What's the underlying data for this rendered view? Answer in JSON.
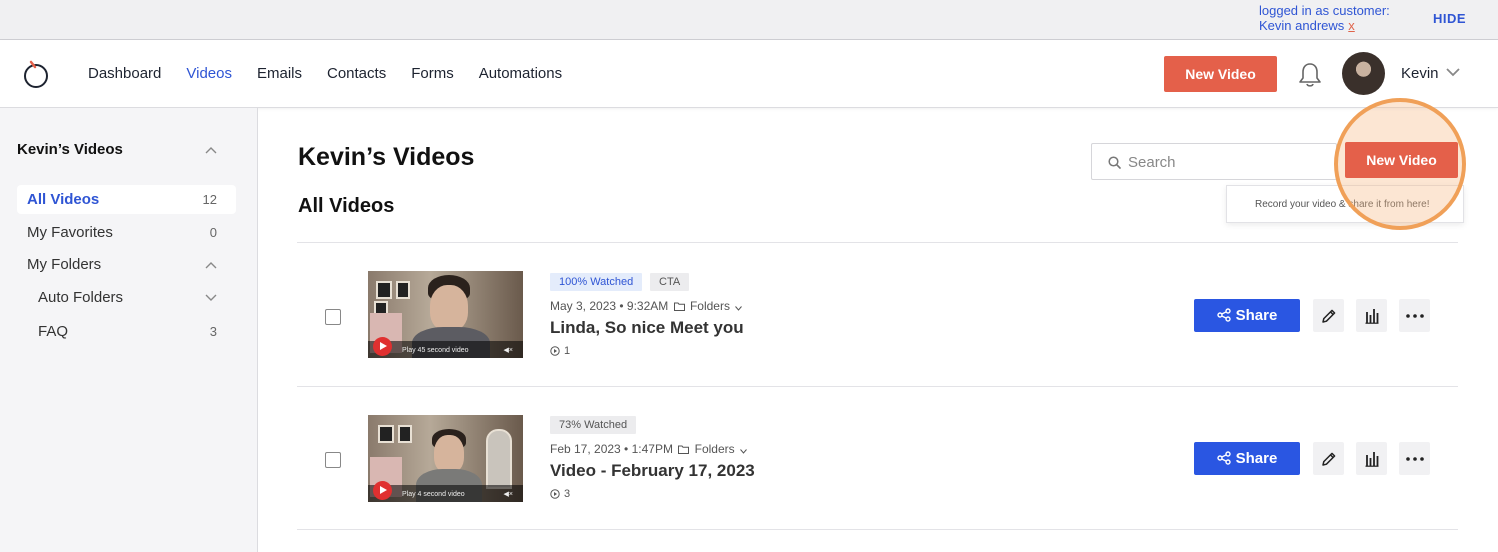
{
  "customer_bar": {
    "line1": "logged in as customer:",
    "line2": "Kevin andrews",
    "remove": "x",
    "hide": "HIDE"
  },
  "nav": {
    "items": [
      {
        "label": "Dashboard",
        "active": false
      },
      {
        "label": "Videos",
        "active": true
      },
      {
        "label": "Emails",
        "active": false
      },
      {
        "label": "Contacts",
        "active": false
      },
      {
        "label": "Forms",
        "active": false
      },
      {
        "label": "Automations",
        "active": false
      }
    ],
    "new_video": "New Video",
    "user_name": "Kevin"
  },
  "sidebar": {
    "title": "Kevin’s Videos",
    "items": [
      {
        "label": "All Videos",
        "count": "12"
      },
      {
        "label": "My Favorites",
        "count": "0"
      },
      {
        "label": "My Folders",
        "count": ""
      },
      {
        "label": "Auto Folders",
        "count": ""
      },
      {
        "label": "FAQ",
        "count": "3"
      }
    ]
  },
  "main": {
    "title": "Kevin’s Videos",
    "subtitle": "All Videos",
    "search_placeholder": "Search",
    "new_video": "New Video",
    "tooltip": "Record your video & share it from here!"
  },
  "videos": [
    {
      "badges": [
        "100% Watched",
        "CTA"
      ],
      "date": "May 3, 2023 • 9:32AM",
      "folder": "Folders",
      "title": "Linda, So nice Meet you",
      "views": "1",
      "play_label": "Play 45 second video",
      "share": "Share"
    },
    {
      "badges": [
        "73% Watched"
      ],
      "date": "Feb 17, 2023 • 1:47PM",
      "folder": "Folders",
      "title": "Video - February 17, 2023",
      "views": "3",
      "play_label": "Play 4 second video",
      "share": "Share"
    }
  ],
  "colors": {
    "accent_orange": "#e4604a",
    "primary_blue": "#2a56e2",
    "link_blue": "#2f55d4"
  }
}
